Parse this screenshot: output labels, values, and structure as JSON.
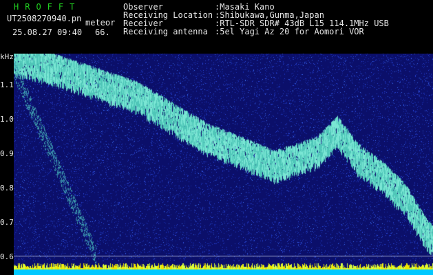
{
  "header": {
    "title": "HROFFT",
    "filename": "UT2508270940.pn",
    "tag": "meteor",
    "datetime": "25.08.27 09:40",
    "count": "66.",
    "fields": [
      {
        "label": "Observer",
        "value": ":Masaki Kano"
      },
      {
        "label": "Receiving Location",
        "value": ":Shibukawa,Gunma,Japan"
      },
      {
        "label": "Receiver",
        "value": ":RTL-SDR SDR# 43dB L15 114.1MHz USB"
      },
      {
        "label": "Receiving antenna",
        "value": ":5el Yagi Az 20 for Aomori VOR"
      }
    ]
  },
  "axis": {
    "unit": "kHz",
    "y_ticks": [
      "1.1",
      "1.0",
      "0.9",
      "0.8",
      "0.7",
      "0.6"
    ],
    "x_ticks": [
      "094",
      "094",
      "094",
      "094",
      "094",
      "094",
      "094",
      "094",
      "094",
      "0950"
    ]
  },
  "colors": {
    "background": "#000000",
    "noise": "#1a1f9a",
    "signal": "#5fd6c6",
    "tick_text": "#f0e600",
    "title": "#21d121",
    "baseline_band": "#00c8ff"
  }
}
